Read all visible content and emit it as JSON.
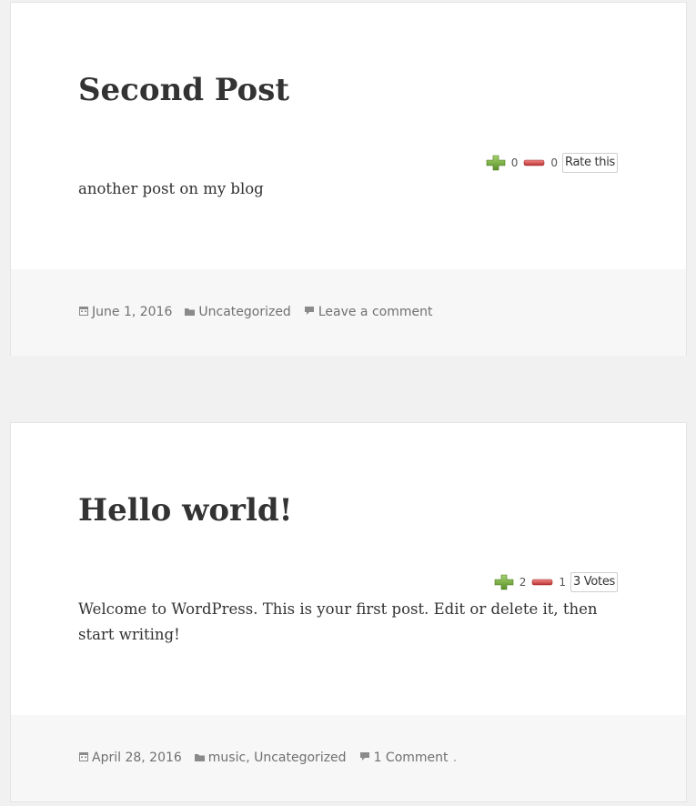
{
  "posts": [
    {
      "title": "Second Post",
      "likes": "0",
      "dislikes": "0",
      "rating_label": "Rate this",
      "content": "another post on my blog",
      "date": "June 1, 2016",
      "categories": [
        "Uncategorized"
      ],
      "comments_link": "Leave a comment"
    },
    {
      "title": "Hello world!",
      "likes": "2",
      "dislikes": "1",
      "rating_label": "3 Votes",
      "content": "Welcome to WordPress. This is your first post. Edit or delete it, then start writing!",
      "date": "April 28, 2016",
      "categories": [
        "music",
        "Uncategorized"
      ],
      "category_separator": ", ",
      "comments_link": "1 Comment"
    }
  ],
  "icons": {
    "thumb_up": "thumb-up-icon",
    "thumb_down": "thumb-down-icon",
    "calendar": "calendar-icon",
    "folder": "folder-icon",
    "comment": "comment-icon"
  },
  "colors": {
    "page_background": "#f1f1f1",
    "card_background": "#ffffff",
    "footer_background": "#f7f7f7",
    "text": "#333333",
    "meta_text": "#707070",
    "thumb_up": "#7cb342",
    "thumb_down": "#d9534f"
  }
}
